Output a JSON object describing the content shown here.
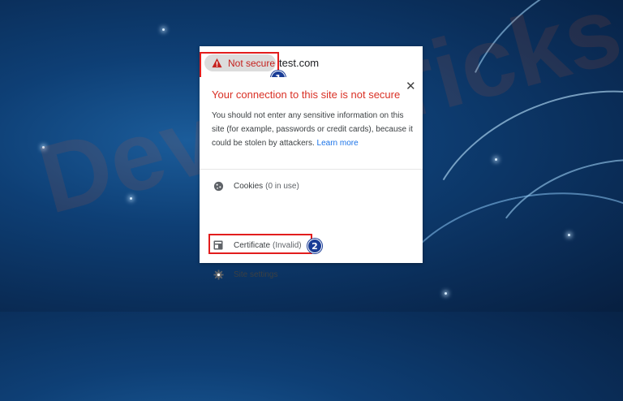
{
  "address_bar": {
    "security_chip_label": "Not secure",
    "url": "test.com"
  },
  "annotations": {
    "badge_1": "1",
    "badge_2": "2"
  },
  "popup": {
    "close_symbol": "✕",
    "title": "Your connection to this site is not secure",
    "description": "You should not enter any sensitive information on this site (for example, passwords or credit cards), because it could be stolen by attackers.",
    "learn_more": "Learn more",
    "items": [
      {
        "icon": "cookie-icon",
        "label": "Cookies",
        "detail": "(0 in use)"
      },
      {
        "icon": "certificate-icon",
        "label": "Certificate",
        "detail": "(Invalid)"
      },
      {
        "icon": "gear-icon",
        "label": "Site settings",
        "detail": ""
      }
    ]
  },
  "watermark": "DeviceTricks",
  "colors": {
    "warning_red": "#c5221f",
    "highlight_red": "#e21d1d",
    "link_blue": "#1a73e8",
    "badge_blue": "#1a3d96"
  }
}
